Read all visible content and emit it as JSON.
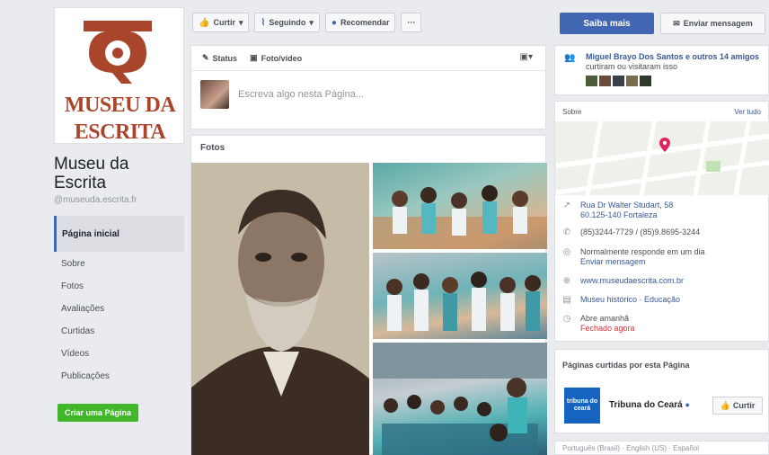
{
  "page": {
    "logo_line1": "MUSEU DA",
    "logo_line2": "ESCRITA",
    "name": "Museu da Escrita",
    "handle": "@museuda.escrita.fr"
  },
  "nav": {
    "items": [
      "Página inicial",
      "Sobre",
      "Fotos",
      "Avaliações",
      "Curtidas",
      "Vídeos",
      "Publicações"
    ],
    "create_page": "Criar uma Página"
  },
  "actions": {
    "like": "Curtir",
    "following": "Seguindo",
    "recommend": "Recomendar",
    "more": "···",
    "learn_more": "Saiba mais",
    "send_message": "Enviar mensagem"
  },
  "composer": {
    "tab_status": "Status",
    "tab_photo": "Foto/vídeo",
    "placeholder": "Escreva algo nesta Página..."
  },
  "photos": {
    "title": "Fotos"
  },
  "friends": {
    "names": "Miguel Brayo Dos Santos e outros 14 amigos",
    "suffix": "curtiram ou visitaram isso"
  },
  "about": {
    "title": "Sobre",
    "see_all": "Ver tudo",
    "address_line1": "Rua Dr Walter Studart, 58",
    "address_line2": "60.125-140 Fortaleza",
    "phone": "(85)3244-7729 / (85)9.8695-3244",
    "response_line1": "Normalmente responde em um dia",
    "response_line2": "Enviar mensagem",
    "website": "www.museudaescrita.com.br",
    "category": "Museu histórico · Educação",
    "hours_line1": "Abre amanhã",
    "hours_line2": "Fechado agora"
  },
  "liked_pages": {
    "title": "Páginas curtidas por esta Página",
    "logo_text": "tribuna do ceará",
    "name": "Tribuna do Ceará",
    "like_button": "Curtir"
  },
  "bottom": {
    "text": "Português (Brasil) · English (US) · Español"
  },
  "colors": {
    "brand_blue": "#4267b2",
    "logo_red": "#a8452b",
    "create_green": "#42b72a",
    "closed_red": "#e02f2f"
  }
}
